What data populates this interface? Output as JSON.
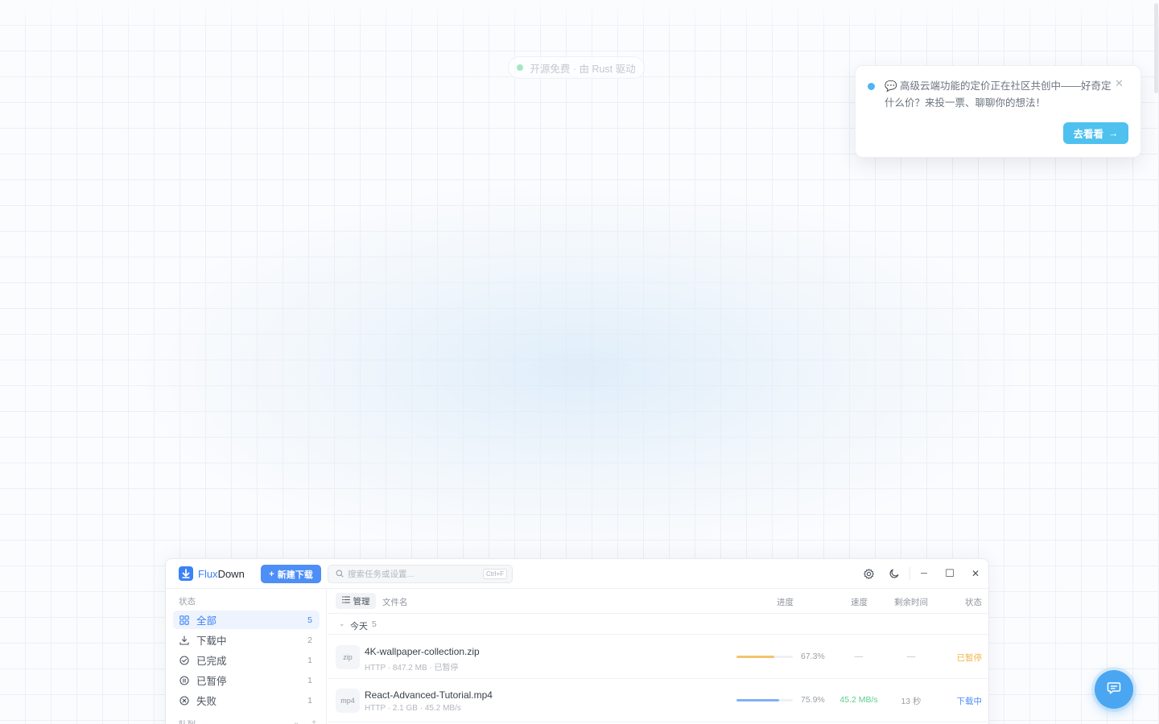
{
  "background": {
    "badge_text": "开源免费 · 由 Rust 驱动"
  },
  "notification": {
    "text": "💬 高级云端功能的定价正在社区共创中——好奇定什么价？来投一票、聊聊你的想法！",
    "close": "✕",
    "button_label": "去看看",
    "arrow": "→"
  },
  "titlebar": {
    "app_name_accent": "Flux",
    "app_name_rest": "Down",
    "new_download_label": "新建下载",
    "plus": "+",
    "search_placeholder": "搜索任务或设置...",
    "search_value": "",
    "shortcut": "Ctrl+F",
    "minimize": "─",
    "maximize": "☐",
    "close": "✕"
  },
  "sidebar": {
    "status_heading": "状态",
    "items": [
      {
        "label": "全部",
        "count": "5",
        "icon": "grid-icon",
        "active": true
      },
      {
        "label": "下载中",
        "count": "2",
        "icon": "download-icon",
        "active": false
      },
      {
        "label": "已完成",
        "count": "1",
        "icon": "check-circle-icon",
        "active": false
      },
      {
        "label": "已暂停",
        "count": "1",
        "icon": "pause-circle-icon",
        "active": false
      },
      {
        "label": "失败",
        "count": "1",
        "icon": "x-circle-icon",
        "active": false
      }
    ],
    "queue_heading": "队列",
    "queue_tools": "⌄ +"
  },
  "table": {
    "manage_label": "管理",
    "columns": {
      "filename": "文件名",
      "progress": "进度",
      "speed": "速度",
      "remaining": "剩余时间",
      "status": "状态"
    },
    "group": {
      "chevron": "⌄",
      "label": "今天",
      "count": "5"
    },
    "rows": [
      {
        "ext": "zip",
        "filename": "4K-wallpaper-collection.zip",
        "meta": "HTTP · 847.2 MB · 已暂停",
        "progress": 0.673,
        "progress_text": "67.3%",
        "progress_color": "#f5c26b",
        "speed": "—",
        "eta": "—",
        "status": "已暂停",
        "status_color": "#f0b54a"
      },
      {
        "ext": "mp4",
        "filename": "React-Advanced-Tutorial.mp4",
        "meta": "HTTP · 2.1 GB · 45.2 MB/s",
        "progress": 0.759,
        "progress_text": "75.9%",
        "progress_color": "#7fb0f7",
        "speed": "45.2 MB/s",
        "speed_color": "#5ccf8c",
        "eta": "13 秒",
        "status": "下载中",
        "status_color": "#4d8ef7"
      }
    ]
  },
  "colors": {
    "accent": "#3c82f6",
    "notice_button": "#4ec1ee",
    "chat_fab": "#4aa6f1"
  }
}
